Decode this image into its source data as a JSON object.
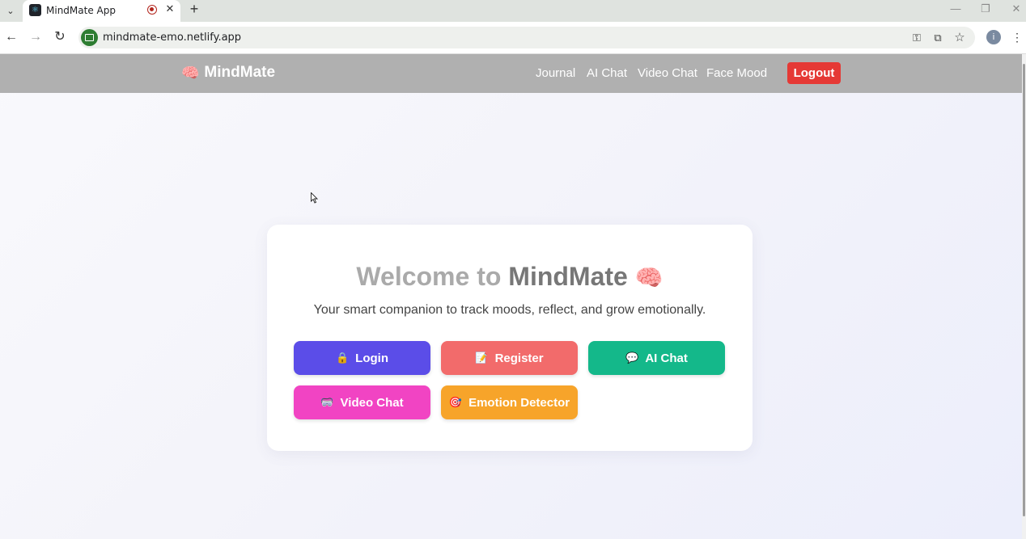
{
  "browser": {
    "tab_title": "MindMate App",
    "url": "mindmate-emo.netlify.app",
    "profile_initial": "i"
  },
  "navbar": {
    "brand_icon": "🧠",
    "brand_name": "MindMate",
    "links": [
      "Journal",
      "AI Chat",
      "Video Chat",
      "Face Mood"
    ],
    "logout_label": "Logout"
  },
  "hero": {
    "welcome_lead": "Welcome to ",
    "welcome_brand": "MindMate",
    "welcome_emoji": "🧠",
    "tagline": "Your smart companion to track moods, reflect, and grow emotionally.",
    "buttons": [
      {
        "icon": "🔒",
        "label": "Login",
        "color": "#5b4de8"
      },
      {
        "icon": "📝",
        "label": "Register",
        "color": "#f26b6b"
      },
      {
        "icon": "💬",
        "label": "AI Chat",
        "color": "#14b88a"
      },
      {
        "icon": "🥽",
        "label": "Video Chat",
        "color": "#f144c3"
      },
      {
        "icon": "🎯",
        "label": "Emotion Detector",
        "color": "#f7a42a"
      }
    ]
  },
  "colors": {
    "navbar_bg": "#b0b0b0",
    "logout_bg": "#e53935"
  }
}
